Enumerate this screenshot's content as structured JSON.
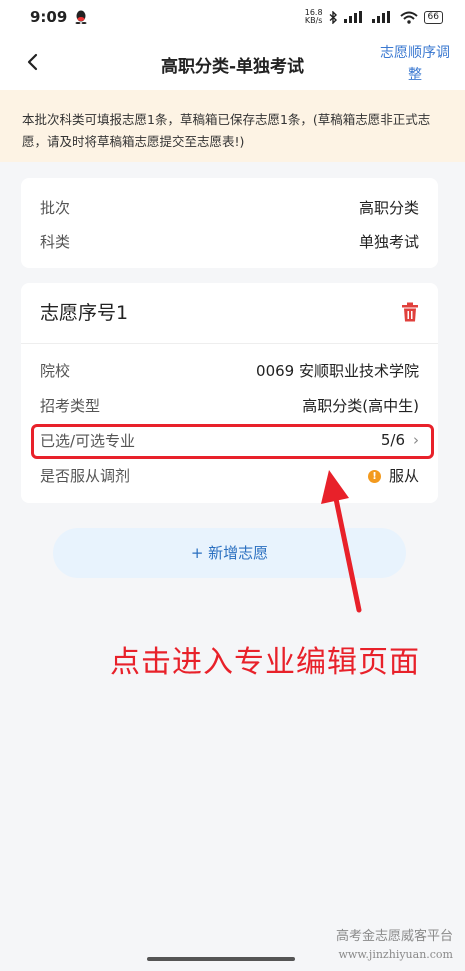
{
  "status_bar": {
    "time": "9:09",
    "net_speed_value": "16.8",
    "net_speed_unit": "KB/s",
    "battery": "66"
  },
  "nav": {
    "title": "高职分类-单独考试",
    "action_label_line1": "志愿顺序调",
    "action_label_line2": "整"
  },
  "notice": {
    "text": "本批次科类可填报志愿1条，草稿箱已保存志愿1条，(草稿箱志愿非正式志愿，请及时将草稿箱志愿提交至志愿表!)"
  },
  "batch_card": {
    "rows": [
      {
        "label": "批次",
        "value": "高职分类"
      },
      {
        "label": "科类",
        "value": "单独考试"
      }
    ]
  },
  "choice_card": {
    "title": "志愿序号1",
    "rows": [
      {
        "label": "院校",
        "value": "0069 安顺职业技术学院"
      },
      {
        "label": "招考类型",
        "value": "高职分类(高中生)"
      },
      {
        "label": "已选/可选专业",
        "value": "5/6"
      },
      {
        "label": "是否服从调剂",
        "value": "服从"
      }
    ]
  },
  "add_button": {
    "plus": "+",
    "label": "新增志愿"
  },
  "annotation": "点击进入专业编辑页面",
  "watermark": {
    "line1": "高考金志愿威客平台",
    "line2": "www.jinzhiyuan.com"
  },
  "colors": {
    "accent": "#3a78d0",
    "highlight_red": "#e8212a",
    "notice_bg": "#fdf3e4",
    "warn_orange": "#f39a1e",
    "delete_red": "#e0403c"
  }
}
